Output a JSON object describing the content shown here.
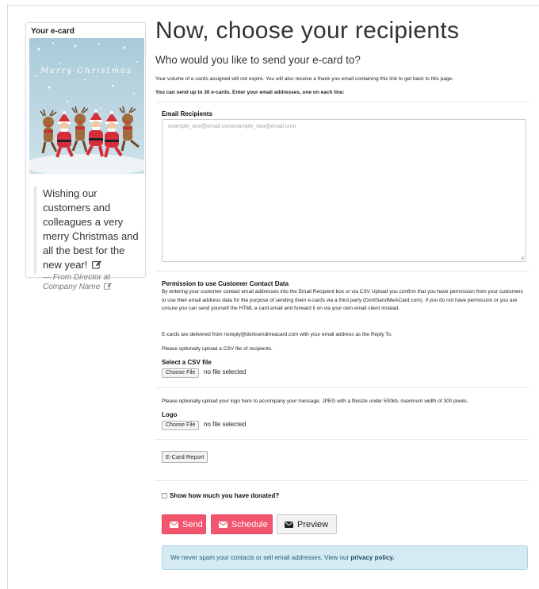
{
  "sidebar": {
    "card_title": "Your e-card",
    "card_image_text": "Merry Christmas",
    "message": "Wishing our customers and colleagues a very merry Christmas and all the best for the new year!",
    "from": "— From Director at Company Name"
  },
  "main": {
    "title": "Now, choose your recipients",
    "subtitle": "Who would you like to send your e-card to?",
    "info_line": "Your volume of e-cards assigned will not expire. You will also receive a thank you email containing this link to get back to this page.",
    "limit_line": "You can send up to 30 e-cards. Enter your email addresses, one on each line:",
    "recipients_label": "Email Recipients",
    "recipients_placeholder": "example_one@email.comexample_two@email.com",
    "permission_heading": "Permission to use Customer Contact Data",
    "permission_text": "By entering your customer contact email addresses into the Email Recipient box or via CSV Upload you confirm that you have permission from your customers to use their email address data for the purpose of sending them e-cards via a third party (DontSendMeACard.com). If you do not have permission or you are unsure you can send yourself the HTML e-card email and forward it on via your own email client instead.",
    "delivery_text": "E-cards are delivered from noreply@dontsendmeacard.com with your email address as the Reply To.",
    "csv_prompt": "Please optionally upload a CSV file of recipients.",
    "csv_label": "Select a CSV file",
    "choose_file": "Choose File",
    "no_file": "no file selected",
    "logo_prompt": "Please optionally upload your logo here to accompany your message. JPEG with a filesize under 500kb, maximum width of 300 pixels.",
    "logo_label": "Logo",
    "report_button": "E-Card Report",
    "donated_label": "Show how much you have donated?",
    "send_button": "Send",
    "schedule_button": "Schedule",
    "preview_button": "Preview",
    "alert_text": "We never spam your contacts or sell email addresses. View our ",
    "alert_link": "privacy policy."
  },
  "colors": {
    "accent_red": "#f2556e",
    "alert_bg": "#d4ebf3",
    "card_sky": "#b7d2de"
  }
}
